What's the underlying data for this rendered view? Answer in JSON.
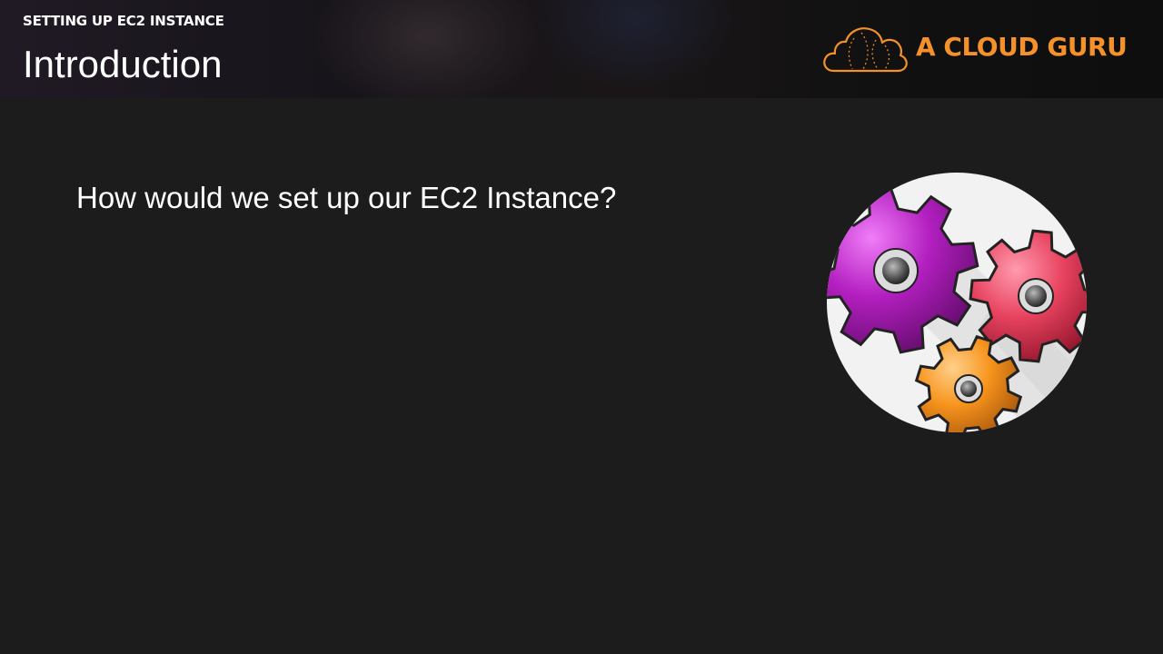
{
  "header": {
    "subtitle": "SETTING UP EC2 INSTANCE",
    "title": "Introduction"
  },
  "logo": {
    "text": "A CLOUD GURU",
    "icon": "cloud-icon",
    "color": "#f5912a"
  },
  "content": {
    "question": "How would we set up our EC2 Instance?"
  },
  "illustration": {
    "icon": "gears-icon",
    "colors": {
      "gear_purple": "#b31fc0",
      "gear_red": "#e8435f",
      "gear_orange": "#f7941d"
    }
  },
  "colors": {
    "background": "#1c1c1c",
    "accent": "#f5912a"
  }
}
